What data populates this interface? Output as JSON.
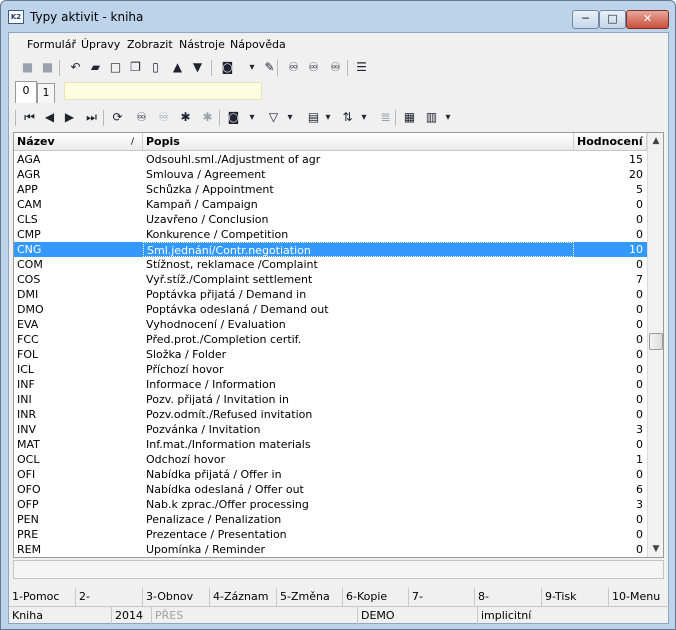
{
  "window": {
    "title": "Typy aktivit - kniha",
    "min": "─",
    "max": "□",
    "close": "✕",
    "app_icon": "K2"
  },
  "menu": [
    "Formulář",
    "Úpravy",
    "Zobrazit",
    "Nástroje",
    "Nápověda"
  ],
  "tabs": [
    {
      "label": "0"
    },
    {
      "label": "1"
    }
  ],
  "columns": {
    "code": "Název",
    "desc": "Popis",
    "rating": "Hodnocení",
    "sort_indicator": "/"
  },
  "rows": [
    {
      "code": "AGA",
      "desc": "Odsouhl.sml./Adjustment of agr",
      "rating": "15"
    },
    {
      "code": "AGR",
      "desc": "Smlouva / Agreement",
      "rating": "20"
    },
    {
      "code": "APP",
      "desc": "Schůzka / Appointment",
      "rating": "5"
    },
    {
      "code": "CAM",
      "desc": "Kampaň / Campaign",
      "rating": "0"
    },
    {
      "code": "CLS",
      "desc": "Uzavřeno / Conclusion",
      "rating": "0"
    },
    {
      "code": "CMP",
      "desc": "Konkurence / Competition",
      "rating": "0"
    },
    {
      "code": "CNG",
      "desc": "Sml.jednání/Contr.negotiation",
      "rating": "10",
      "selected": true
    },
    {
      "code": "COM",
      "desc": "Stížnost, reklamace /Complaint",
      "rating": "0"
    },
    {
      "code": "COS",
      "desc": "Vyř.stíž./Complaint settlement",
      "rating": "7"
    },
    {
      "code": "DMI",
      "desc": "Poptávka přijatá / Demand in",
      "rating": "0"
    },
    {
      "code": "DMO",
      "desc": "Poptávka odeslaná / Demand out",
      "rating": "0"
    },
    {
      "code": "EVA",
      "desc": "Vyhodnocení / Evaluation",
      "rating": "0"
    },
    {
      "code": "FCC",
      "desc": "Před.prot./Completion certif.",
      "rating": "0"
    },
    {
      "code": "FOL",
      "desc": "Složka / Folder",
      "rating": "0"
    },
    {
      "code": "ICL",
      "desc": "Příchozí hovor",
      "rating": "0"
    },
    {
      "code": "INF",
      "desc": "Informace / Information",
      "rating": "0"
    },
    {
      "code": "INI",
      "desc": "Pozv. přijatá / Invitation in",
      "rating": "0"
    },
    {
      "code": "INR",
      "desc": "Pozv.odmít./Refused invitation",
      "rating": "0"
    },
    {
      "code": "INV",
      "desc": "Pozvánka / Invitation",
      "rating": "3"
    },
    {
      "code": "MAT",
      "desc": "Inf.mat./Information materials",
      "rating": "0"
    },
    {
      "code": "OCL",
      "desc": "Odchozí hovor",
      "rating": "1"
    },
    {
      "code": "OFI",
      "desc": "Nabídka přijatá / Offer in",
      "rating": "0"
    },
    {
      "code": "OFO",
      "desc": "Nabídka odeslaná / Offer out",
      "rating": "6"
    },
    {
      "code": "OFP",
      "desc": "Nab.k zprac./Offer processing",
      "rating": "3"
    },
    {
      "code": "PEN",
      "desc": "Penalizace / Penalization",
      "rating": "0"
    },
    {
      "code": "PRE",
      "desc": "Prezentace / Presentation",
      "rating": "0"
    },
    {
      "code": "REM",
      "desc": "Upomínka / Reminder",
      "rating": "0"
    }
  ],
  "fkeys": [
    "1-Pomoc",
    "2-",
    "3-Obnov",
    "4-Záznam",
    "5-Změna",
    "6-Kopie",
    "7-",
    "8-",
    "9-Tisk",
    "10-Menu"
  ],
  "status": {
    "book": "Kniha",
    "year": "2014",
    "pres": "PŘES",
    "db": "DEMO",
    "mode": "implicitní"
  },
  "toolbar1_icons": [
    {
      "name": "save-icon",
      "glyph": "■",
      "dim": true
    },
    {
      "name": "save-all-icon",
      "glyph": "■",
      "dim": true
    },
    {
      "name": "undo-icon",
      "glyph": "↶"
    },
    {
      "name": "open-folder-icon",
      "glyph": "▰"
    },
    {
      "name": "new-document-icon",
      "glyph": "□"
    },
    {
      "name": "copy-icon",
      "glyph": "❐"
    },
    {
      "name": "book-icon",
      "glyph": "▯"
    },
    {
      "name": "arrow-up-icon",
      "glyph": "▲"
    },
    {
      "name": "arrow-down-icon",
      "glyph": "▼"
    },
    {
      "name": "camera-icon",
      "glyph": "◙"
    },
    {
      "name": "dropdown-icon",
      "glyph": "▾"
    },
    {
      "name": "export-icon",
      "glyph": "✎"
    },
    {
      "name": "binoculars-icon",
      "glyph": "♾"
    },
    {
      "name": "find-next-icon",
      "glyph": "♾"
    },
    {
      "name": "find-all-icon",
      "glyph": "♾"
    },
    {
      "name": "menu-lines-icon",
      "glyph": "☰"
    }
  ],
  "toolbar2_icons": [
    {
      "name": "first-record-icon",
      "glyph": "⏮"
    },
    {
      "name": "previous-record-icon",
      "glyph": "◀"
    },
    {
      "name": "next-record-icon",
      "glyph": "▶"
    },
    {
      "name": "last-record-icon",
      "glyph": "⏭"
    },
    {
      "name": "refresh-icon",
      "glyph": "⟳"
    },
    {
      "name": "search-icon",
      "glyph": "♾"
    },
    {
      "name": "search-disabled-icon",
      "glyph": "♾",
      "dim": true
    },
    {
      "name": "add-star-icon",
      "glyph": "✱"
    },
    {
      "name": "remove-star-icon",
      "glyph": "✱",
      "dim": true
    },
    {
      "name": "camera-icon",
      "glyph": "◙"
    },
    {
      "name": "dropdown-icon",
      "glyph": "▾"
    },
    {
      "name": "filter-icon",
      "glyph": "▽"
    },
    {
      "name": "dropdown-icon",
      "glyph": "▾"
    },
    {
      "name": "layout-icon",
      "glyph": "▤"
    },
    {
      "name": "dropdown-icon",
      "glyph": "▾"
    },
    {
      "name": "sort-az-icon",
      "glyph": "⇅"
    },
    {
      "name": "dropdown-icon",
      "glyph": "▾"
    },
    {
      "name": "list-icon",
      "glyph": "≣",
      "dim": true
    },
    {
      "name": "excel-export-icon",
      "glyph": "▦"
    },
    {
      "name": "columns-icon",
      "glyph": "▥"
    },
    {
      "name": "dropdown-icon",
      "glyph": "▾"
    }
  ],
  "colors": {
    "selection": "#3399ff",
    "tab_field": "#fffde0",
    "frame": "#bcd3ea"
  }
}
